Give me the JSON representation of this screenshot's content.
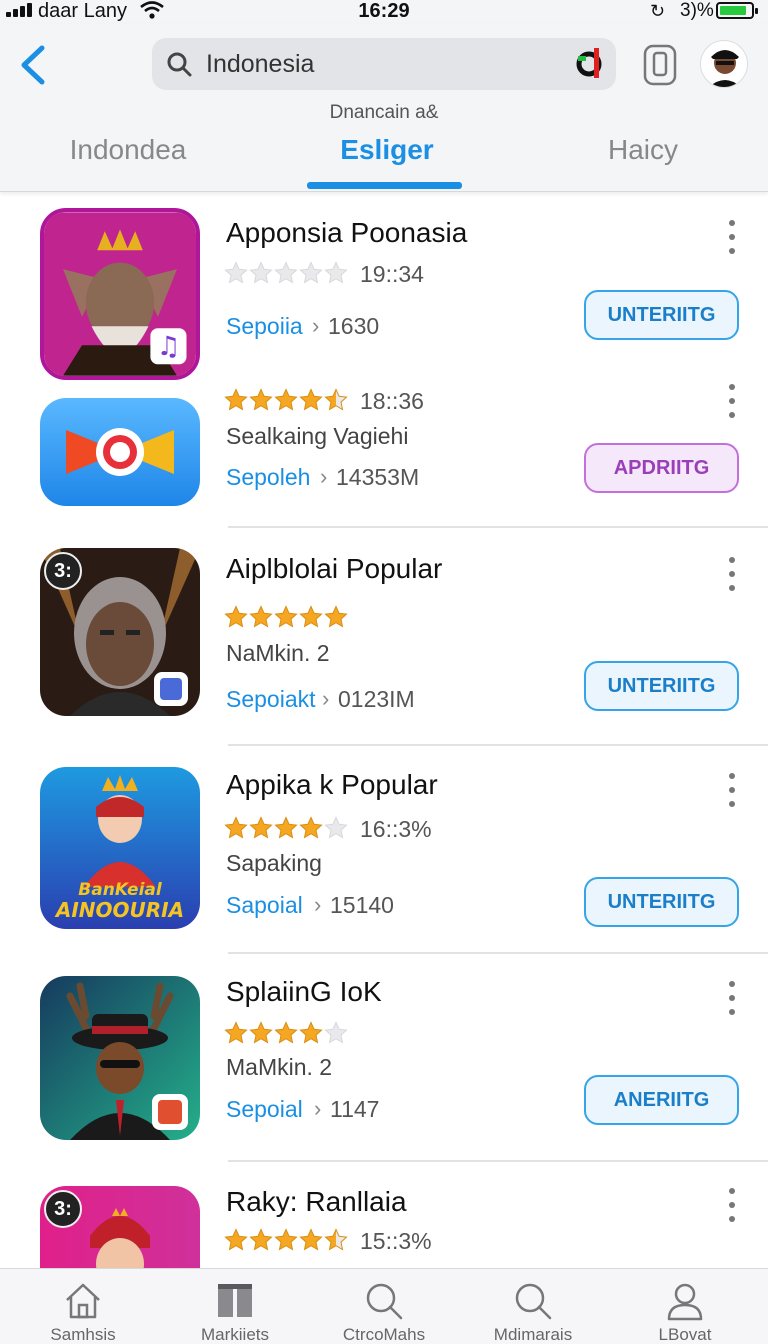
{
  "status_bar": {
    "carrier": "daar Lany",
    "time": "16:29",
    "battery": "3)%"
  },
  "header": {
    "search_value": "Indonesia",
    "subtitle": "Dnancain a&",
    "tabs": [
      {
        "label": "Indondea",
        "active": false
      },
      {
        "label": "Esliger",
        "active": true
      },
      {
        "label": "Haicy",
        "active": false
      }
    ]
  },
  "apps": [
    {
      "title": "Apponsia Poonasia",
      "rating": 0,
      "rating_time": "19::34",
      "subtitle": "",
      "category": "Sepoiia",
      "size": "1630",
      "button": "UNTERIITG",
      "button_style": "blue",
      "badge": ""
    },
    {
      "title": "",
      "rating": 4.5,
      "rating_time": "18::36",
      "subtitle": "Sealkaing Vagiehi",
      "category": "Sepoleh",
      "size": "14353M",
      "button": "APDRIITG",
      "button_style": "purple",
      "badge": ""
    },
    {
      "title": "Aiplblolai Popular",
      "rating": 5,
      "rating_time": "",
      "subtitle": "NaMkin. 2",
      "category": "Sepoiakt",
      "size": "0123IM",
      "button": "UNTERIITG",
      "button_style": "blue",
      "badge": "3:"
    },
    {
      "title": "Appika k Popular",
      "rating": 4,
      "rating_time": "16::3%",
      "subtitle": "Sapaking",
      "category": "Sapoial",
      "size": "15140",
      "button": "UNTERIITG",
      "button_style": "blue",
      "badge": ""
    },
    {
      "title": "SplaiinG IoK",
      "rating": 4,
      "rating_time": "",
      "subtitle": "MaMkin. 2",
      "category": "Sepoial",
      "size": "1147",
      "button": "ANERIITG",
      "button_style": "blue",
      "badge": ""
    },
    {
      "title": "Raky: Ranllaia",
      "rating": 4.5,
      "rating_time": "15::3%",
      "subtitle": "",
      "category": "",
      "size": "",
      "button": "",
      "button_style": "blue",
      "badge": "3:"
    }
  ],
  "bottom_nav": [
    {
      "label": "Samhsis",
      "icon": "home-icon"
    },
    {
      "label": "Markiiets",
      "icon": "book-icon"
    },
    {
      "label": "CtrcoMahs",
      "icon": "search-icon"
    },
    {
      "label": "Mdimarais",
      "icon": "search-icon"
    },
    {
      "label": "LBovat",
      "icon": "person-icon"
    }
  ],
  "colors": {
    "accent": "#1a8fe3",
    "star": "#f5a623",
    "purple": "#c470dc"
  }
}
